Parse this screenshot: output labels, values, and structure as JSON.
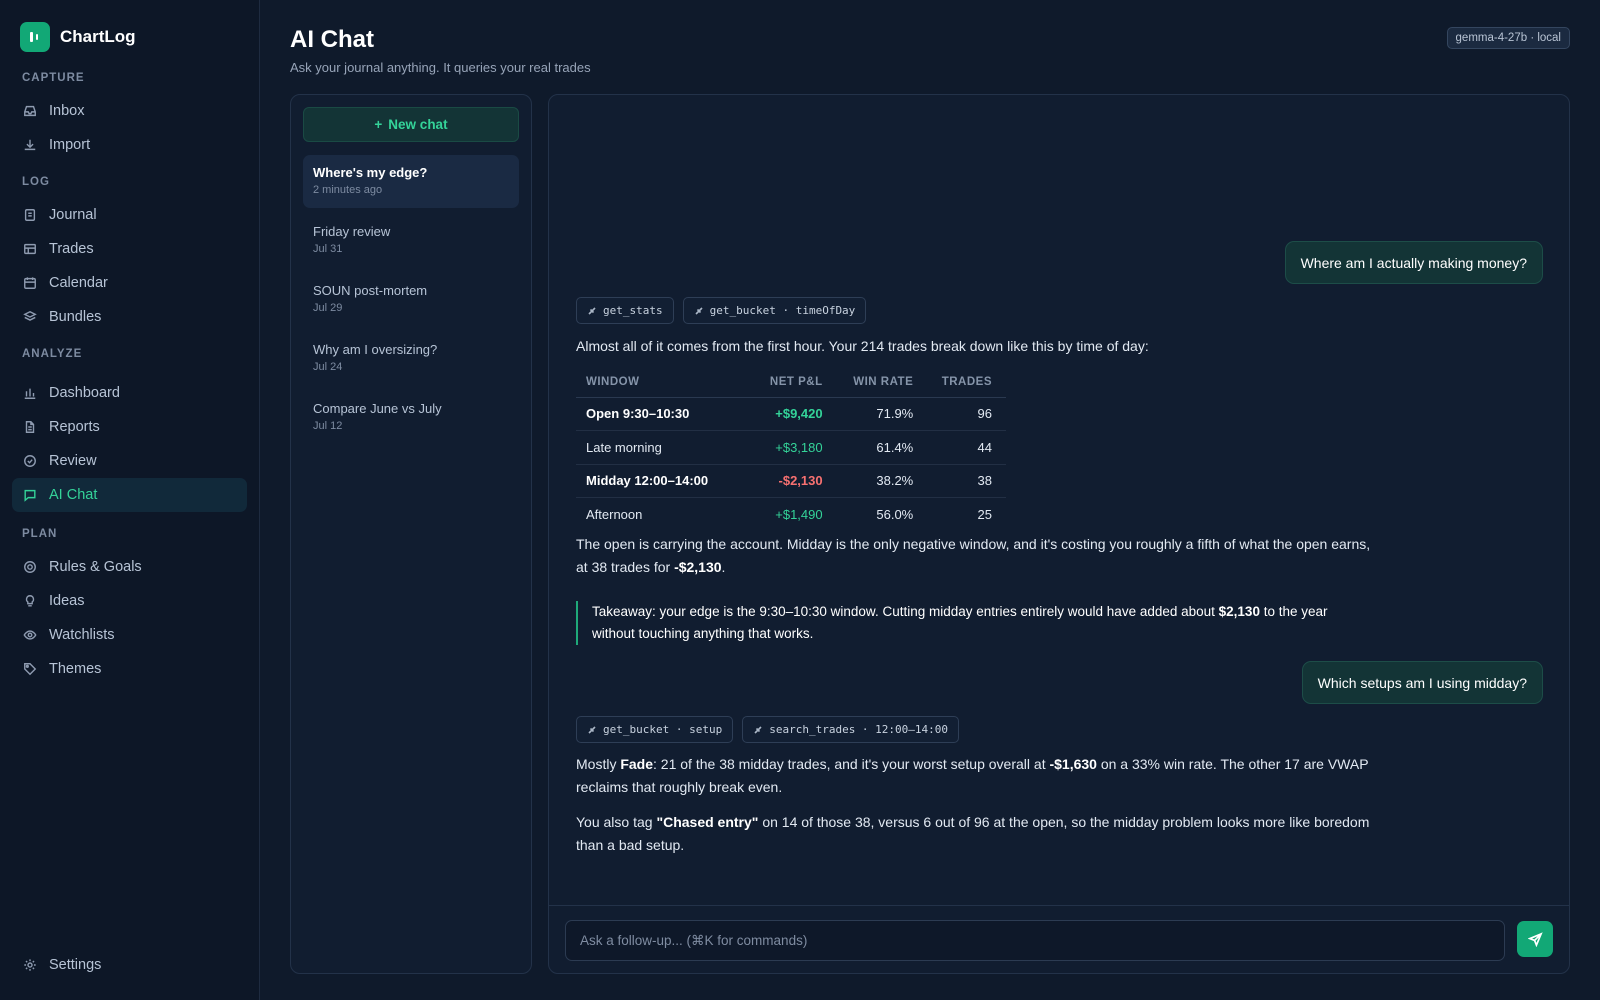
{
  "brand": {
    "name": "ChartLog"
  },
  "sidebar": {
    "sections": {
      "capture": "CAPTURE",
      "log": "LOG",
      "analyze": "ANALYZE",
      "plan": "PLAN"
    },
    "items": {
      "inbox": "Inbox",
      "import": "Import",
      "journal": "Journal",
      "trades": "Trades",
      "calendar": "Calendar",
      "bundles": "Bundles",
      "dashboard": "Dashboard",
      "reports": "Reports",
      "review": "Review",
      "ai_chat": "AI Chat",
      "rules_goals": "Rules & Goals",
      "ideas": "Ideas",
      "watchlists": "Watchlists",
      "themes": "Themes",
      "settings": "Settings"
    },
    "active": "AI Chat"
  },
  "header": {
    "title": "AI Chat",
    "subtitle": "Ask your journal anything. It queries your real trades",
    "model_badge": "gemma-4-27b · local"
  },
  "chat_list": {
    "new_chat_label": "New chat",
    "new_chat_icon": "+",
    "items": [
      {
        "title": "Where's my edge?",
        "date": "2 minutes ago"
      },
      {
        "title": "Friday review",
        "date": "Jul 31"
      },
      {
        "title": "SOUN post-mortem",
        "date": "Jul 29"
      },
      {
        "title": "Why am I oversizing?",
        "date": "Jul 24"
      },
      {
        "title": "Compare June vs July",
        "date": "Jul 12"
      }
    ]
  },
  "conversation": {
    "q1": "Where am I actually making money?",
    "tools1": [
      "get_stats",
      "get_bucket · timeOfDay"
    ],
    "intro": "Almost all of it comes from the first hour. Your 214 trades break down like this by time of day:",
    "table": {
      "headers": [
        "WINDOW",
        "NET P&L",
        "WIN RATE",
        "TRADES"
      ],
      "rows": [
        {
          "window": "Open 9:30–10:30",
          "pnl": "+$9,420",
          "win_rate": "71.9%",
          "trades": "96"
        },
        {
          "window": "Late morning",
          "pnl": "+$3,180",
          "win_rate": "61.4%",
          "trades": "44"
        },
        {
          "window": "Midday 12:00–14:00",
          "pnl": "-$2,130",
          "win_rate": "38.2%",
          "trades": "38"
        },
        {
          "window": "Afternoon",
          "pnl": "+$1,490",
          "win_rate": "56.0%",
          "trades": "25"
        }
      ]
    },
    "p2_pre": "The open is carrying the account. Midday is the only negative window, and it's costing you roughly a fifth of what the open earns, at 38 trades for ",
    "p2_bold": "-$2,130",
    "p2_post": ".",
    "takeaway_pre": "Takeaway: your edge is the 9:30–10:30 window. Cutting midday entries entirely would have added about ",
    "takeaway_bold": "$2,130",
    "takeaway_post": " to the year without touching anything that works.",
    "q2": "Which setups am I using midday?",
    "tools2": [
      "get_bucket · setup",
      "search_trades · 12:00–14:00"
    ],
    "p3_pre": "Mostly ",
    "p3_b1": "Fade",
    "p3_mid": ": 21 of the 38 midday trades, and it's your worst setup overall at ",
    "p3_b2": "-$1,630",
    "p3_post": " on a 33% win rate. The other 17 are VWAP reclaims that roughly break even.",
    "p4_pre": "You also tag ",
    "p4_bold": "\"Chased entry\"",
    "p4_post": " on 14 of those 38, versus 6 out of 96 at the open, so the midday problem looks more like boredom than a bad setup."
  },
  "composer": {
    "placeholder": "Ask a follow-up... (⌘K for commands)"
  },
  "colors": {
    "accent": "#34d399",
    "negative": "#f87171",
    "brand": "#12a876"
  }
}
